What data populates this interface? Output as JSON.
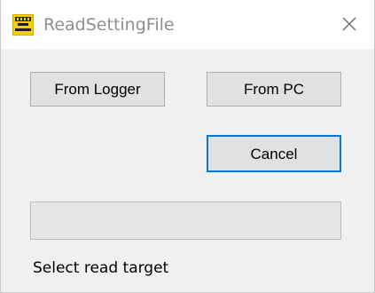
{
  "window": {
    "title": "ReadSettingFile",
    "icon": "e-log-app-icon",
    "close_icon": "close-icon"
  },
  "buttons": {
    "from_logger": "From Logger",
    "from_pc": "From PC",
    "cancel": "Cancel"
  },
  "progress": {
    "value": 0
  },
  "status": {
    "message": "Select read target"
  },
  "colors": {
    "focus_accent": "#0078d7",
    "icon_yellow": "#f5cf00",
    "progress_fill": "#06b025"
  }
}
